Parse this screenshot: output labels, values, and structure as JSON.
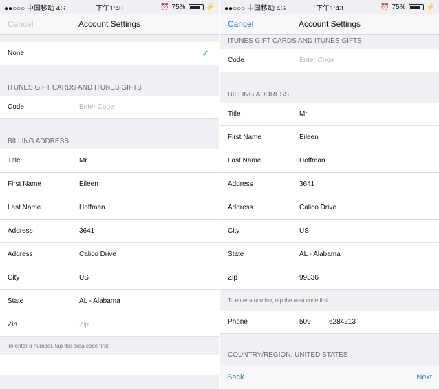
{
  "left": {
    "status": {
      "carrier": "●●○○○ 中国移动 4G",
      "time": "下午1:40",
      "battery": "75%",
      "battery_fraction": 0.75
    },
    "nav": {
      "cancel": "Cancel",
      "title": "Account Settings"
    },
    "payment_selected": "None",
    "gift_header": "ITUNES GIFT CARDS AND ITUNES GIFTS",
    "code": {
      "label": "Code",
      "placeholder": "Enter Code"
    },
    "billing_header": "BILLING ADDRESS",
    "rows": [
      {
        "label": "Title",
        "value": "Mr."
      },
      {
        "label": "First Name",
        "value": "Eileen"
      },
      {
        "label": "Last Name",
        "value": "Hoffman"
      },
      {
        "label": "Address",
        "value": "3641"
      },
      {
        "label": "Address",
        "value": "Calico Drive"
      },
      {
        "label": "City",
        "value": "US"
      },
      {
        "label": "State",
        "value": "AL - Alabama"
      }
    ],
    "zip": {
      "label": "Zip",
      "placeholder": "Zip"
    },
    "note": "To enter a number, tap the area code first."
  },
  "right": {
    "status": {
      "carrier": "●●○○○ 中国移动 4G",
      "time": "下午1:43",
      "battery": "75%",
      "battery_fraction": 0.75
    },
    "nav": {
      "cancel": "Cancel",
      "title": "Account Settings"
    },
    "gift_header": "ITUNES GIFT CARDS AND ITUNES GIFTS",
    "code": {
      "label": "Code",
      "placeholder": "Enter Code"
    },
    "billing_header": "BILLING ADDRESS",
    "rows": [
      {
        "label": "Title",
        "value": "Mr."
      },
      {
        "label": "First Name",
        "value": "Eileen"
      },
      {
        "label": "Last Name",
        "value": "Hoffman"
      },
      {
        "label": "Address",
        "value": "3641"
      },
      {
        "label": "Address",
        "value": "Calico Drive"
      },
      {
        "label": "City",
        "value": "US"
      },
      {
        "label": "State",
        "value": "AL - Alabama"
      },
      {
        "label": "Zip",
        "value": "99336"
      }
    ],
    "note": "To enter a number, tap the area code first.",
    "phone": {
      "label": "Phone",
      "area": "509",
      "number": "6284213"
    },
    "country_header": "COUNTRY/REGION: UNITED STATES",
    "toolbar": {
      "back": "Back",
      "next": "Next"
    }
  },
  "colors": {
    "accent": "#1a83d6",
    "background": "#efeff4"
  }
}
